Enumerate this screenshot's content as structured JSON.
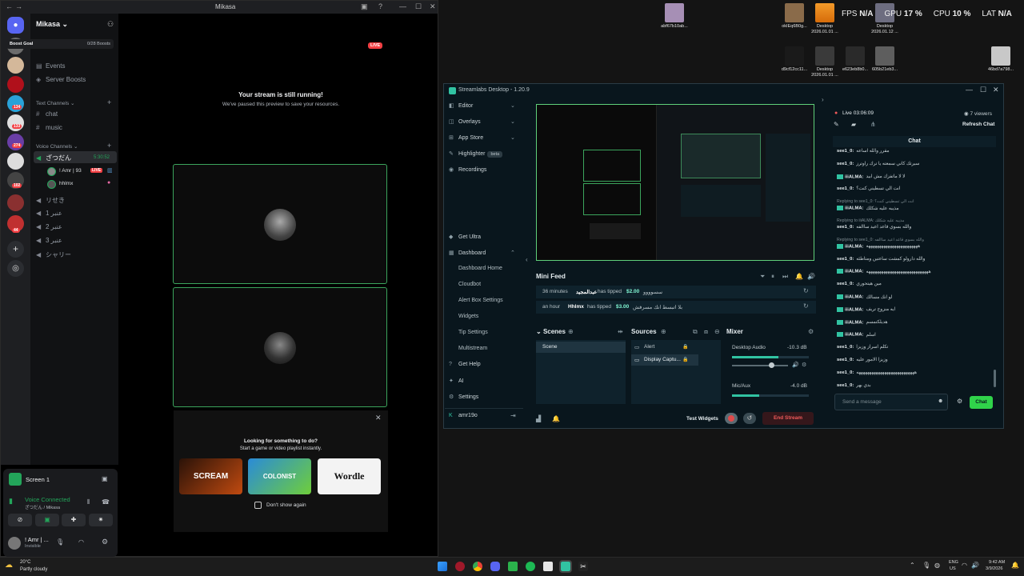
{
  "hud": {
    "fps_label": "FPS",
    "fps": "N/A",
    "gpu_label": "GPU",
    "gpu": "17 %",
    "cpu_label": "CPU",
    "cpu": "10 %",
    "lat_label": "LAT",
    "lat": "N/A"
  },
  "desktop_icons": [
    {
      "label": "abf67b10ab...",
      "color": "#a68fb5"
    },
    {
      "label": "okIEq6B0g...",
      "color": "#8a6b4a"
    },
    {
      "label": "Desktop\n2026.01.01 ...",
      "color": "#e88a1e"
    },
    {
      "label": "Desktop\n2026.01.12 ...",
      "color": "#7a7a8a"
    },
    {
      "label": "d9cf12cc11...",
      "color": "#1a1a1a"
    },
    {
      "label": "Desktop\n2026.01.01 ...",
      "color": "#3a3a3a"
    },
    {
      "label": "e623eb8b0...",
      "color": "#2a2a2a"
    },
    {
      "label": "605b21eb3...",
      "color": "#6a6a6a"
    },
    {
      "label": "46bd7a798...",
      "color": "#c8c8c8"
    }
  ],
  "discord": {
    "window_title": "Mikasa",
    "server_name": "Mikasa",
    "boost_goal": "Boost Goal",
    "boost_count": "0/28 Boosts",
    "events": "Events",
    "server_boosts": "Server Boosts",
    "text_channels": "Text Channels",
    "channels": [
      "chat",
      "music"
    ],
    "voice_channels": "Voice Channels",
    "voice_active": "ざつだん",
    "voice_timer": "5:30:52",
    "members": [
      {
        "name": "! Amr | 93",
        "live": "LIVE"
      },
      {
        "name": "hhlmx"
      }
    ],
    "other_voice": [
      "リせき",
      "عنبر 1",
      "عنبر 2",
      "عنبر 3",
      "シャリー"
    ],
    "guild_badges": [
      "134",
      "133",
      "274",
      "102",
      "44"
    ],
    "live_badge": "LIVE",
    "stream_title": "Your stream is still running!",
    "stream_sub": "We've paused this preview to save your resources.",
    "promo_title": "Looking for something to do?",
    "promo_sub": "Start a game or video playlist instantly.",
    "games": [
      "SCREAM",
      "COLONIST",
      "Wordle"
    ],
    "dont_show": "Don't show again",
    "screen_label": "Screen 1",
    "voice_connected": "Voice Connected",
    "voice_location": "ざつだん / Mikasa",
    "user_name": "! Amr | ...",
    "user_status": "Invisible"
  },
  "streamlabs": {
    "title": "Streamlabs Desktop - 1.20.9",
    "nav": [
      "Editor",
      "Overlays",
      "App Store",
      "Highlighter",
      "Recordings",
      "Get Ultra",
      "Dashboard",
      "Dashboard Home",
      "Cloudbot",
      "Alert Box Settings",
      "Widgets",
      "Tip Settings",
      "Multistream",
      "Get Help",
      "AI",
      "Settings"
    ],
    "beta": "beta",
    "account": "amr19o",
    "live_time": "Live 03:06:09",
    "viewers": "7 viewers",
    "refresh_chat": "Refresh Chat",
    "chat_label": "Chat",
    "mini_feed": "Mini Feed",
    "feed": [
      {
        "time": "36 minutes",
        "user": "عبدالمجيد",
        "verb": "has tipped",
        "amount": "$2.00",
        "msg": "سسوووو"
      },
      {
        "time": "an hour",
        "user": "Hhlmx",
        "verb": "has tipped",
        "amount": "$3.00",
        "msg": "بلا اتبسط انك مسرفش"
      }
    ],
    "scenes_label": "Scenes",
    "scene_item": "Scene",
    "sources_label": "Sources",
    "sources": [
      "Alert",
      "Display Captu..."
    ],
    "mixer_label": "Mixer",
    "mixer": [
      {
        "name": "Desktop Audio",
        "db": "-10.3 dB"
      },
      {
        "name": "Mic/Aux",
        "db": "-4.0 dB"
      }
    ],
    "test_widgets": "Test Widgets",
    "end_stream": "End Stream",
    "send_placeholder": "Send a message",
    "chat_button": "Chat",
    "chat_messages": [
      {
        "user": "see1_0:",
        "text": "مقرر والله اساعه",
        "badge": false
      },
      {
        "user": "see1_0:",
        "text": "سيرتك كاني سمعته يا ترك راوترز",
        "badge": false
      },
      {
        "user": "iiiALMA:",
        "text": "لا لا ماتفزك مش ابيد",
        "badge": true
      },
      {
        "user": "see1_0:",
        "text": "انت الي تسطيني كنت؟",
        "badge": false
      },
      {
        "user": "iiiALMA:",
        "text": "مذيبه عليه شكلك",
        "badge": true,
        "reply": "Replying to see1_0: انت الي تسطيني كنت؟"
      },
      {
        "user": "see1_0:",
        "text": "والله بسوي قاعد اعيد ساالفه",
        "badge": false,
        "reply": "Replying to iiiALMA: مذيبه عليه شكلك"
      },
      {
        "user": "iiiALMA:",
        "text": "ههههههههههههههههههههههههه",
        "badge": true,
        "reply": "Replying to see1_0: والله بسوي قاعد اعيد ساالفه"
      },
      {
        "user": "see1_0:",
        "text": "والله دارولو كمشت ساعتين ومتاطئه",
        "badge": false
      },
      {
        "user": "iiiALMA:",
        "text": "هههههههههههههههههههههههههههههه",
        "badge": true
      },
      {
        "user": "see1_0:",
        "text": "مين هيتحوري",
        "badge": false
      },
      {
        "user": "iiiALMA:",
        "text": "لو انك مسالك",
        "badge": true
      },
      {
        "user": "iiiALMA:",
        "text": "ايه منزوج تريف",
        "badge": true
      },
      {
        "user": "iiiALMA:",
        "text": "هديلكتمسم",
        "badge": true
      },
      {
        "user": "iiiALMA:",
        "text": "اسلم",
        "badge": true
      },
      {
        "user": "see1_0:",
        "text": "تكلم اسراز وزيزا",
        "badge": false
      },
      {
        "user": "see1_0:",
        "text": "وزيزا الامور عليه",
        "badge": false
      },
      {
        "user": "see1_0:",
        "text": "هههههههههههههههههههههههههههه",
        "badge": false
      },
      {
        "user": "see1_0:",
        "text": "بدي بهر",
        "badge": false
      }
    ]
  },
  "taskbar": {
    "weather_temp": "20°C",
    "weather_desc": "Partly cloudy",
    "lang": "ENG",
    "region": "US",
    "time": "9:42 AM",
    "date": "3/9/2026"
  }
}
